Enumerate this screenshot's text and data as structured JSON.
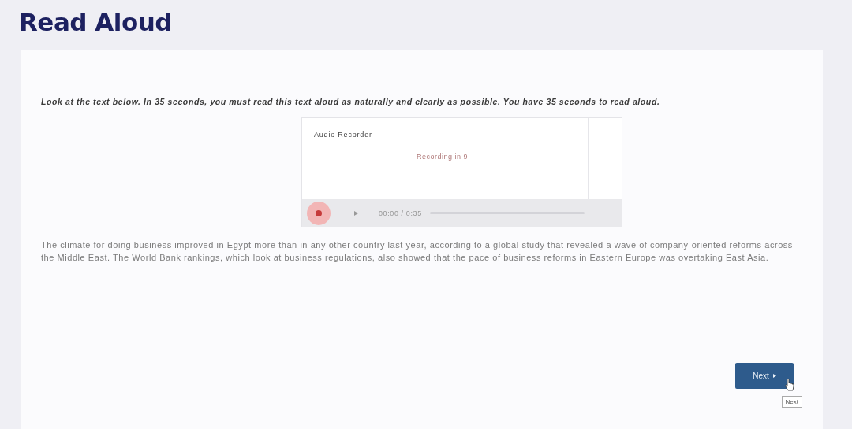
{
  "page_title": "Read Aloud",
  "instruction": "Look at the text below. In 35 seconds, you must read this text aloud as naturally and clearly as possible. You have 35 seconds to read aloud.",
  "recorder": {
    "title": "Audio Recorder",
    "status": "Recording in 9",
    "time": "00:00 / 0:35"
  },
  "passage": "The climate for doing business improved in Egypt more than in any other country last year, according to a global study that revealed a wave of company-oriented reforms across the Middle East. The World Bank rankings, which look at business regulations, also showed that the pace of business reforms in Eastern Europe was overtaking East Asia.",
  "next_button": {
    "label": "Next",
    "tooltip": "Next"
  }
}
